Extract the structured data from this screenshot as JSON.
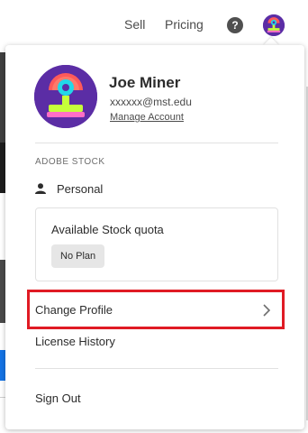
{
  "header": {
    "nav": [
      {
        "label": "Sell"
      },
      {
        "label": "Pricing"
      }
    ],
    "help_icon": "help-icon",
    "avatar_icon": "avatar"
  },
  "account_menu": {
    "user": {
      "name": "Joe Miner",
      "email": "xxxxxx@mst.edu",
      "manage_account_label": "Manage Account"
    },
    "section_label": "ADOBE STOCK",
    "profile": {
      "icon": "person-icon",
      "label": "Personal"
    },
    "quota": {
      "title": "Available Stock quota",
      "plan_badge": "No Plan"
    },
    "change_profile_label": "Change Profile",
    "change_profile_icon": "chevron-right-icon",
    "license_history_label": "License History",
    "sign_out_label": "Sign Out"
  },
  "colors": {
    "highlight": "#e01b24",
    "avatar_bg": "#5b2da5",
    "text": "#2c2c2c"
  }
}
